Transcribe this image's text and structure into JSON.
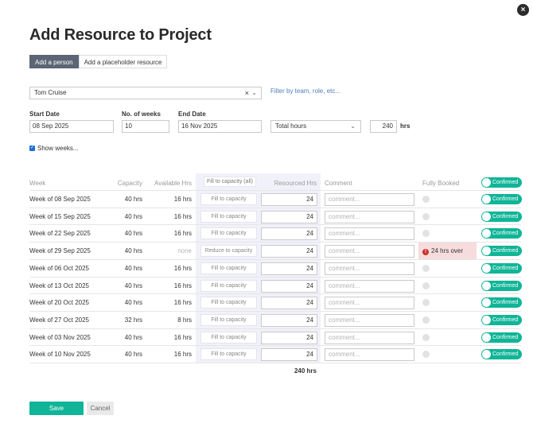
{
  "dialog": {
    "title": "Add Resource to Project",
    "close_icon": "×"
  },
  "tabs": [
    {
      "label": "Add a person",
      "active": true
    },
    {
      "label": "Add a placeholder resource",
      "active": false
    }
  ],
  "person": {
    "value": "Tom Cruise",
    "clear_icon": "×",
    "chevron_icon": "⌄",
    "filter_link": "Filter by team, role, etc..."
  },
  "form": {
    "start_date_label": "Start Date",
    "start_date": "08 Sep 2025",
    "weeks_label": "No. of weeks",
    "weeks": "10",
    "end_date_label": "End Date",
    "end_date": "16 Nov 2025",
    "total_hours_select": "Total hours",
    "total_hours_value": "240",
    "hours_unit": "hrs",
    "show_weeks_label": "Show weeks...",
    "show_weeks_checked": true
  },
  "table": {
    "headers": {
      "week": "Week",
      "capacity": "Capacity",
      "available": "Available Hrs",
      "fill_all": "Fill to capacity (all)",
      "resourced": "Resourced Hrs",
      "comment": "Comment",
      "fully_booked": "Fully Booked",
      "confirmed_toggle": "Confirmed"
    },
    "comment_placeholder": "comment...",
    "rows": [
      {
        "week": "Week of 08 Sep 2025",
        "capacity": "40 hrs",
        "available": "16 hrs",
        "fill": "Fill to capacity",
        "resourced": "24",
        "status": "Confirmed"
      },
      {
        "week": "Week of 15 Sep 2025",
        "capacity": "40 hrs",
        "available": "16 hrs",
        "fill": "Fill to capacity",
        "resourced": "24",
        "status": "Confirmed"
      },
      {
        "week": "Week of 22 Sep 2025",
        "capacity": "40 hrs",
        "available": "16 hrs",
        "fill": "Fill to capacity",
        "resourced": "24",
        "status": "Confirmed"
      },
      {
        "week": "Week of 29 Sep 2025",
        "capacity": "40 hrs",
        "available": "none",
        "fill": "Reduce to capacity",
        "resourced": "24",
        "over": "24 hrs over",
        "status": "Confirmed"
      },
      {
        "week": "Week of 06 Oct 2025",
        "capacity": "40 hrs",
        "available": "16 hrs",
        "fill": "Fill to capacity",
        "resourced": "24",
        "status": "Confirmed"
      },
      {
        "week": "Week of 13 Oct 2025",
        "capacity": "40 hrs",
        "available": "16 hrs",
        "fill": "Fill to capacity",
        "resourced": "24",
        "status": "Confirmed"
      },
      {
        "week": "Week of 20 Oct 2025",
        "capacity": "40 hrs",
        "available": "16 hrs",
        "fill": "Fill to capacity",
        "resourced": "24",
        "status": "Confirmed"
      },
      {
        "week": "Week of 27 Oct 2025",
        "capacity": "32 hrs",
        "available": "8 hrs",
        "fill": "Fill to capacity",
        "resourced": "24",
        "status": "Confirmed"
      },
      {
        "week": "Week of 03 Nov 2025",
        "capacity": "40 hrs",
        "available": "16 hrs",
        "fill": "Fill to capacity",
        "resourced": "24",
        "status": "Confirmed"
      },
      {
        "week": "Week of 10 Nov 2025",
        "capacity": "40 hrs",
        "available": "16 hrs",
        "fill": "Fill to capacity",
        "resourced": "24",
        "status": "Confirmed"
      }
    ],
    "total": "240 hrs"
  },
  "actions": {
    "save": "Save",
    "cancel": "Cancel"
  },
  "colors": {
    "accent": "#10b597",
    "active_tab": "#5b6574",
    "link": "#4d7fb8",
    "over_bg": "#f6dcdc",
    "alert": "#c9302c"
  }
}
